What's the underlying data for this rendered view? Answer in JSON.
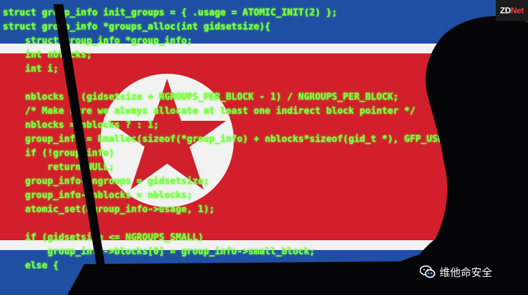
{
  "photo": {
    "subject": "hacker silhouette with laptop in front of North Korean flag with green source code overlay",
    "colors": {
      "flag_blue": "#1f4fa3",
      "flag_white": "#f2f2f2",
      "flag_red": "#d21f2b",
      "star_red": "#d0202b",
      "code_green": "#7dff3a",
      "silhouette": "#050507"
    }
  },
  "badge": {
    "brand_prefix": "ZD",
    "brand_suffix": "Net"
  },
  "watermark": {
    "icon": "wechat-icon",
    "text": "维他命安全"
  },
  "code_lines": [
    "struct group_info init_groups = { .usage = ATOMIC_INIT(2) };",
    "struct group_info *groups_alloc(int gidsetsize){",
    "    struct group_info *group_info;",
    "    int nblocks;",
    "    int i;",
    "",
    "    nblocks = (gidsetsize + NGROUPS_PER_BLOCK - 1) / NGROUPS_PER_BLOCK;",
    "    /* Make sure we always allocate at least one indirect block pointer */",
    "    nblocks = nblocks ? : 1;",
    "    group_info = kmalloc(sizeof(*group_info) + nblocks*sizeof(gid_t *), GFP_USER);",
    "    if (!group_info)",
    "        return NULL;",
    "    group_info->ngroups = gidsetsize;",
    "    group_info->nblocks = nblocks;",
    "    atomic_set(&group_info->usage, 1);",
    "",
    "    if (gidsetsize <= NGROUPS_SMALL)",
    "        group_info->blocks[0] = group_info->small_block;",
    "    else {"
  ]
}
